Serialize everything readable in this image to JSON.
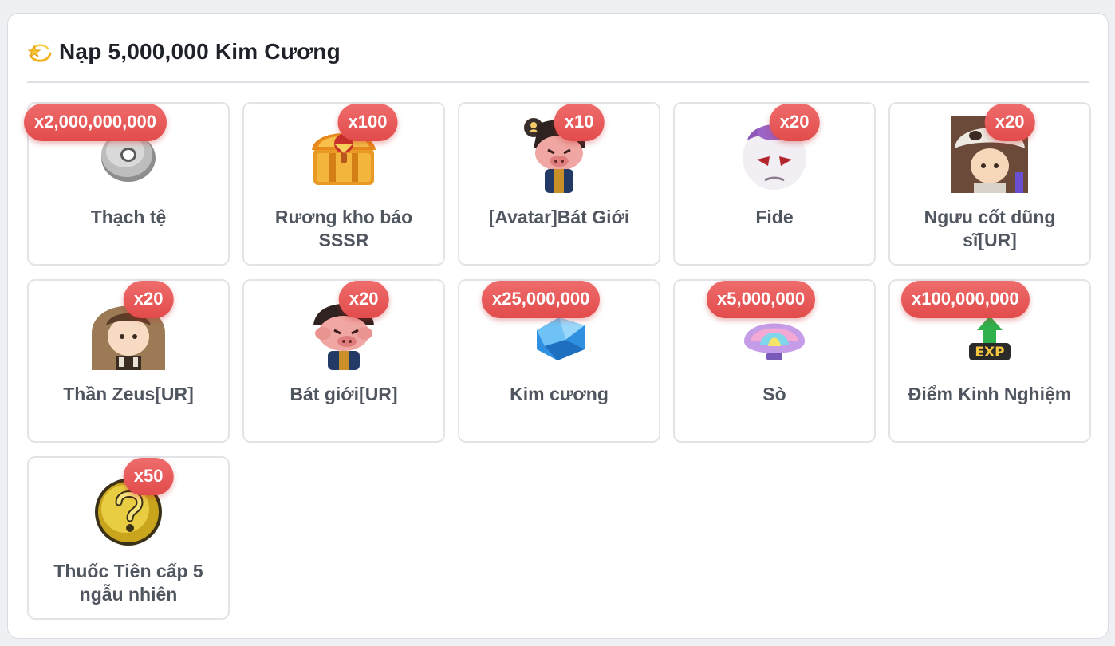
{
  "header": {
    "icon": "dizzy-star-icon",
    "title": "Nạp 5,000,000 Kim Cương"
  },
  "colors": {
    "badge": "#e65454",
    "title": "#1e2128",
    "item_name": "#50565f",
    "card_border": "#e2e4e8"
  },
  "items": [
    {
      "name": "Thạch tệ",
      "qty": "x2,000,000,000",
      "icon": "stone-coin-icon"
    },
    {
      "name": "Rương kho báo SSSR",
      "qty": "x100",
      "icon": "treasure-chest-icon"
    },
    {
      "name": "[Avatar]Bát Giới",
      "qty": "x10",
      "icon": "avatar-pig-warrior-icon"
    },
    {
      "name": "Fide",
      "qty": "x20",
      "icon": "frieza-character-icon"
    },
    {
      "name": "Ngưu cốt dũng sĩ[UR]",
      "qty": "x20",
      "icon": "bone-helmet-warrior-icon"
    },
    {
      "name": "Thần Zeus[UR]",
      "qty": "x20",
      "icon": "zeus-character-icon"
    },
    {
      "name": "Bát giới[UR]",
      "qty": "x20",
      "icon": "pig-warrior-icon"
    },
    {
      "name": "Kim cương",
      "qty": "x25,000,000",
      "icon": "diamond-icon"
    },
    {
      "name": "Sò",
      "qty": "x5,000,000",
      "icon": "seashell-icon"
    },
    {
      "name": "Điểm Kinh Nghiệm",
      "qty": "x100,000,000",
      "icon": "exp-arrow-icon"
    },
    {
      "name": "Thuốc Tiên cấp 5 ngẫu nhiên",
      "qty": "x50",
      "icon": "mystery-coin-icon"
    }
  ]
}
